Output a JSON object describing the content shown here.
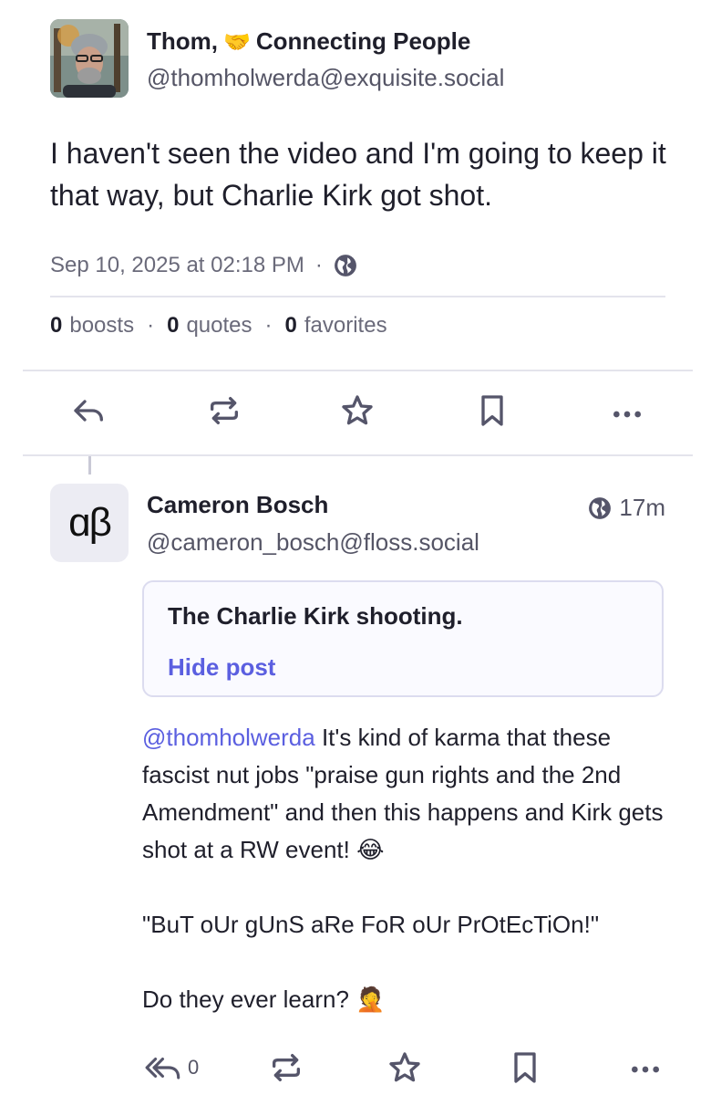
{
  "main_post": {
    "author_name": "Thom,",
    "author_name_suffix": "Connecting People",
    "author_emoji": "🤝",
    "handle": "@thomholwerda@exquisite.social",
    "text": "I haven't seen the video and I'm going to keep it that way, but Charlie Kirk got shot.",
    "timestamp": "Sep 10, 2025 at 02:18 PM",
    "meta_separator": "·",
    "visibility_icon": "globe-icon",
    "counts": {
      "boosts_value": "0",
      "boosts_label": "boosts",
      "quotes_value": "0",
      "quotes_label": "quotes",
      "favorites_value": "0",
      "favorites_label": "favorites",
      "separator": "·"
    },
    "actions": [
      "reply-icon",
      "boost-icon",
      "favorite-icon",
      "bookmark-icon",
      "more-icon"
    ]
  },
  "reply_post": {
    "avatar_text": "ɑβ",
    "author_name": "Cameron Bosch",
    "handle": "@cameron_bosch@floss.social",
    "time": "17m",
    "content_warning": "The Charlie Kirk shooting.",
    "hide_label": "Hide post",
    "mention": "@thomholwerda",
    "paragraph1": " It's kind of karma that these fascist nut jobs \"praise gun rights and the 2nd Amendment\" and then this happens and Kirk gets shot at a RW event! ",
    "paragraph1_emoji": "😂",
    "paragraph2": "\"BuT oUr gUnS aRe FoR oUr PrOtEcTiOn!\"",
    "paragraph3": "Do they ever learn? ",
    "paragraph3_emoji": "🤦",
    "reply_count": "0",
    "actions": [
      "reply-all-icon",
      "boost-icon",
      "favorite-icon",
      "bookmark-icon",
      "more-icon"
    ]
  },
  "colors": {
    "accent": "#5b5fe0",
    "text": "#1f1f2b",
    "muted": "#6a6a7a",
    "divider": "#e4e4ec"
  }
}
